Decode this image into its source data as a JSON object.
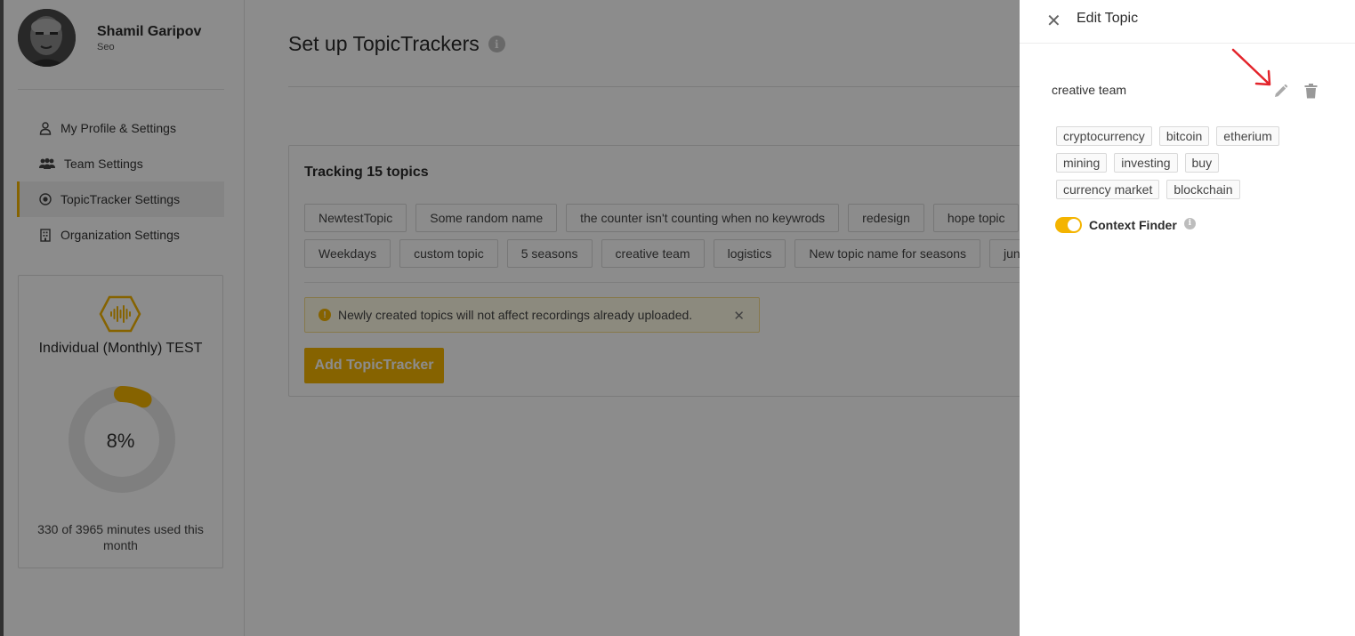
{
  "user": {
    "name": "Shamil Garipov",
    "role": "Seo"
  },
  "nav": {
    "items": [
      {
        "label": "My Profile & Settings",
        "icon": "user-icon",
        "active": false
      },
      {
        "label": "Team Settings",
        "icon": "team-icon",
        "active": false
      },
      {
        "label": "TopicTracker Settings",
        "icon": "target-icon",
        "active": true
      },
      {
        "label": "Organization Settings",
        "icon": "building-icon",
        "active": false
      }
    ]
  },
  "plan": {
    "name": "Individual (Monthly) TEST",
    "percent_label": "8%",
    "usage_fraction": 0.08,
    "usage_text": "330 of 3965 minutes used this month",
    "icon": "audio-wave-hexagon-icon"
  },
  "main": {
    "title": "Set up TopicTrackers",
    "tracking_title": "Tracking 15 topics",
    "topics_row1": [
      "NewtestTopic",
      "Some random name",
      "the counter isn't counting when no keywrods",
      "redesign",
      "hope topic"
    ],
    "topics_row2": [
      "Weekdays",
      "custom topic",
      "5 seasons",
      "creative team",
      "logistics",
      "New topic name for seasons",
      "june"
    ],
    "notice": "Newly created topics will not affect recordings already uploaded.",
    "add_button": "Add TopicTracker"
  },
  "drawer": {
    "title": "Edit Topic",
    "topic_name": "creative team",
    "keywords_rows": [
      [
        "cryptocurrency",
        "bitcoin",
        "etherium"
      ],
      [
        "mining",
        "investing",
        "buy"
      ],
      [
        "currency market",
        "blockchain"
      ]
    ],
    "context_finder_label": "Context Finder",
    "context_finder_on": true
  },
  "colors": {
    "accent": "#f4b400",
    "annotation_arrow": "#e3242b"
  }
}
